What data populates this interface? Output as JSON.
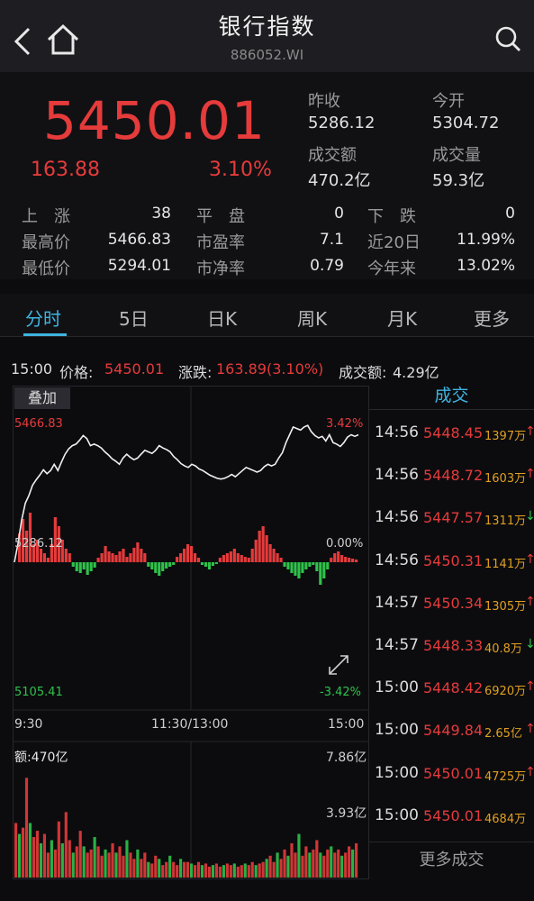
{
  "header": {
    "title": "银行指数",
    "code": "886052.WI"
  },
  "quote": {
    "price": "5450.01",
    "change": "163.88",
    "change_pct": "3.10%",
    "prev_close_label": "昨收",
    "prev_close": "5286.12",
    "open_label": "今开",
    "open": "5304.72",
    "turnover_label": "成交额",
    "turnover": "470.2亿",
    "volume_label": "成交量",
    "volume": "59.3亿",
    "grid": [
      {
        "label": "上　涨",
        "value": "38"
      },
      {
        "label": "平　盘",
        "value": "0"
      },
      {
        "label": "下　跌",
        "value": "0"
      },
      {
        "label": "最高价",
        "value": "5466.83"
      },
      {
        "label": "市盈率",
        "value": "7.1"
      },
      {
        "label": "近20日",
        "value": "11.99%"
      },
      {
        "label": "最低价",
        "value": "5294.01"
      },
      {
        "label": "市净率",
        "value": "0.79"
      },
      {
        "label": "今年来",
        "value": "13.02%"
      }
    ]
  },
  "tabs": [
    "分时",
    "5日",
    "日K",
    "周K",
    "月K",
    "更多"
  ],
  "info_bar": {
    "time": "15:00",
    "price_label": "价格:",
    "price": "5450.01",
    "change_label": "涨跌:",
    "change": "163.89(3.10%)",
    "turnover_label": "成交额:",
    "turnover": "4.29亿"
  },
  "chart": {
    "overlay_label": "叠加",
    "high_price": "5466.83",
    "high_pct": "3.42%",
    "base_price": "5286.12",
    "base_pct": "0.00%",
    "low_price": "5105.41",
    "low_pct": "-3.42%",
    "time_start": "9:30",
    "time_mid": "11:30/13:00",
    "time_end": "15:00",
    "amount_label": "额:470亿",
    "amount_max": "7.86亿",
    "amount_mid": "3.93亿"
  },
  "colors": {
    "up": "#e63b3b",
    "down": "#2fc24a",
    "accent": "#3fb4e0",
    "price_line": "#f0f0f0"
  },
  "chart_data": {
    "type": "line",
    "ylim": [
      5105.41,
      5466.83
    ],
    "base": 5286.12,
    "price": [
      5286.12,
      5310,
      5340,
      5362,
      5372,
      5385,
      5392,
      5398,
      5405,
      5400,
      5404,
      5412,
      5404,
      5415,
      5425,
      5432,
      5436,
      5438,
      5443,
      5449,
      5445,
      5436,
      5438,
      5436,
      5433,
      5428,
      5424,
      5419,
      5416,
      5412,
      5420,
      5425,
      5421,
      5418,
      5420,
      5425,
      5430,
      5428,
      5426,
      5430,
      5436,
      5433,
      5431,
      5428,
      5422,
      5418,
      5413,
      5410,
      5408,
      5412,
      5410,
      5406,
      5404,
      5401,
      5398,
      5396,
      5394,
      5393,
      5394,
      5396,
      5399,
      5396,
      5400,
      5404,
      5408,
      5406,
      5404,
      5402,
      5404,
      5409,
      5412,
      5410,
      5412,
      5420,
      5427,
      5440,
      5450,
      5460,
      5458,
      5456,
      5460,
      5462,
      5454,
      5449,
      5446,
      5448,
      5442,
      5450,
      5440,
      5438,
      5435,
      5440,
      5447,
      5450,
      5448,
      5450
    ],
    "bars": [
      0,
      32,
      48,
      35,
      55,
      20,
      25,
      15,
      10,
      5,
      20,
      50,
      40,
      25,
      15,
      10,
      -5,
      -10,
      -12,
      -8,
      -14,
      -10,
      -6,
      5,
      10,
      18,
      12,
      10,
      8,
      12,
      15,
      6,
      10,
      16,
      22,
      15,
      10,
      -5,
      -8,
      -12,
      -15,
      -10,
      -7,
      -5,
      -3,
      6,
      10,
      15,
      20,
      18,
      10,
      5,
      -3,
      -5,
      -8,
      -4,
      -2,
      5,
      8,
      10,
      12,
      15,
      10,
      8,
      6,
      5,
      15,
      25,
      35,
      40,
      30,
      20,
      15,
      10,
      5,
      -5,
      -8,
      -12,
      -15,
      -18,
      -12,
      -8,
      -5,
      -3,
      -10,
      -25,
      -18,
      -8,
      5,
      10,
      12,
      8,
      6,
      5,
      4,
      3
    ],
    "amount_max": 7.86,
    "amount": [
      3.5,
      2.8,
      3.2,
      6.4,
      3.5,
      2.6,
      3.0,
      2.2,
      2.8,
      1.6,
      2.4,
      1.8,
      3.6,
      2.2,
      4.2,
      2.4,
      1.6,
      2.0,
      3.0,
      2.0,
      1.6,
      1.8,
      2.6,
      2.0,
      1.4,
      1.8,
      1.6,
      2.2,
      1.6,
      2.0,
      1.4,
      2.4,
      1.6,
      1.2,
      1.8,
      1.2,
      1.6,
      1.0,
      0.9,
      1.4,
      1.2,
      0.8,
      1.0,
      1.4,
      1.0,
      0.8,
      1.2,
      1.0,
      1.0,
      0.9,
      0.8,
      1.0,
      0.8,
      0.9,
      0.7,
      0.8,
      0.9,
      0.7,
      0.8,
      0.9,
      0.8,
      0.9,
      0.7,
      0.8,
      0.9,
      0.8,
      1.0,
      0.8,
      0.9,
      1.0,
      1.2,
      1.4,
      1.0,
      1.6,
      1.2,
      1.8,
      1.4,
      2.2,
      1.6,
      2.8,
      1.4,
      2.0,
      1.6,
      1.8,
      2.4,
      1.6,
      1.4,
      1.8,
      2.0,
      1.6,
      1.8,
      1.4,
      1.6,
      2.0,
      1.8,
      2.2
    ]
  },
  "trades": {
    "title": "成交",
    "rows": [
      {
        "time": "14:56",
        "price": "5448.45",
        "vol": "1397万",
        "dir": "↑"
      },
      {
        "time": "14:56",
        "price": "5448.72",
        "vol": "1603万",
        "dir": "↑"
      },
      {
        "time": "14:56",
        "price": "5447.57",
        "vol": "1311万",
        "dir": "↓"
      },
      {
        "time": "14:56",
        "price": "5450.31",
        "vol": "1141万",
        "dir": "↑"
      },
      {
        "time": "14:57",
        "price": "5450.34",
        "vol": "1305万",
        "dir": "↑"
      },
      {
        "time": "14:57",
        "price": "5448.33",
        "vol": "40.8万",
        "dir": "↓"
      },
      {
        "time": "15:00",
        "price": "5448.42",
        "vol": "6920万",
        "dir": "↑"
      },
      {
        "time": "15:00",
        "price": "5449.84",
        "vol": "2.65亿",
        "dir": "↑"
      },
      {
        "time": "15:00",
        "price": "5450.01",
        "vol": "4725万",
        "dir": "↑"
      },
      {
        "time": "15:00",
        "price": "5450.01",
        "vol": "4684万",
        "dir": ""
      }
    ],
    "more_label": "更多成交"
  }
}
